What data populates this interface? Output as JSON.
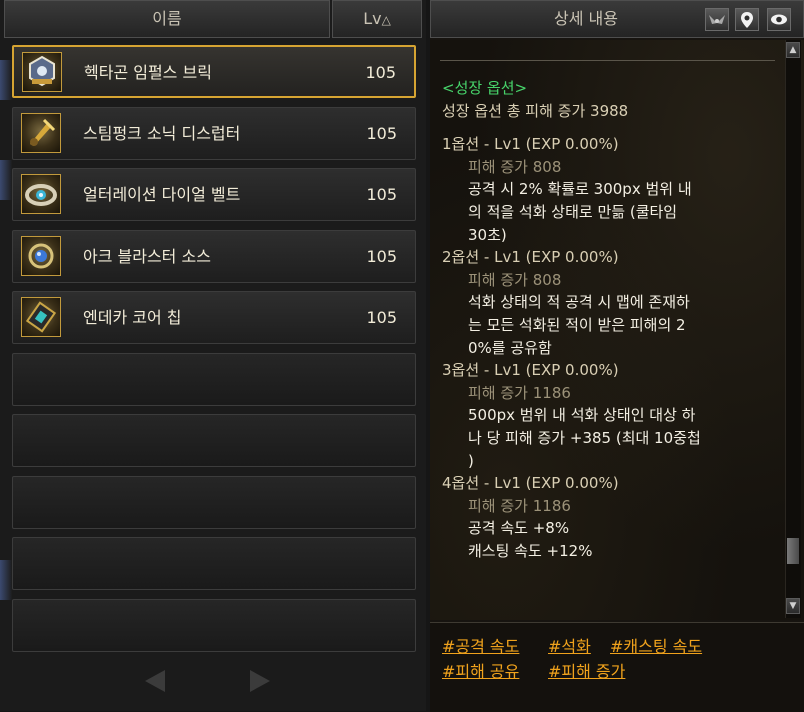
{
  "left_header": {
    "name_label": "이름",
    "lv_label": "Lv",
    "sort_icon": "triangle-up"
  },
  "items": [
    {
      "name": "헥타곤 임펄스 브릭",
      "level": "105",
      "selected": true,
      "icon": "hexagon-brick-icon"
    },
    {
      "name": "스팀펑크 소닉 디스럽터",
      "level": "105",
      "selected": false,
      "icon": "sonic-disruptor-icon"
    },
    {
      "name": "얼터레이션 다이얼 벨트",
      "level": "105",
      "selected": false,
      "icon": "dial-belt-icon"
    },
    {
      "name": "아크 블라스터 소스",
      "level": "105",
      "selected": false,
      "icon": "arc-blaster-icon"
    },
    {
      "name": "엔데카 코어 칩",
      "level": "105",
      "selected": false,
      "icon": "endeca-core-chip-icon"
    }
  ],
  "right_header": {
    "title": "상세 내용",
    "buttons": [
      "wing-icon",
      "map-pin-icon",
      "eye-icon"
    ]
  },
  "detail": {
    "section_title": "<성장 옵션>",
    "total_line": "성장 옵션 총 피해 증가 3988",
    "options": [
      {
        "header": "1옵션 - Lv1 (EXP 0.00%)",
        "damage": "피해 증가 808",
        "desc_lines": [
          "공격 시 2% 확률로 300px 범위 내",
          "의 적을 석화 상태로 만듦 (쿨타임",
          "30초)"
        ]
      },
      {
        "header": "2옵션 - Lv1 (EXP 0.00%)",
        "damage": "피해 증가 808",
        "desc_lines": [
          "석화 상태의 적 공격 시 맵에 존재하",
          "는 모든 석화된 적이 받은 피해의 2",
          "0%를 공유함"
        ]
      },
      {
        "header": "3옵션 - Lv1 (EXP 0.00%)",
        "damage": "피해 증가 1186",
        "desc_lines": [
          "500px 범위 내 석화 상태인 대상 하",
          "나 당 피해 증가 +385 (최대 10중첩",
          ")"
        ]
      },
      {
        "header": "4옵션 - Lv1 (EXP 0.00%)",
        "damage": "피해 증가 1186",
        "desc_lines": [
          "공격 속도 +8%",
          "캐스팅 속도 +12%"
        ]
      }
    ]
  },
  "tags": {
    "row1": [
      "#공격 속도",
      "#석화",
      "#캐스팅 속도"
    ],
    "row2": [
      "#피해 공유",
      "#피해 증가"
    ]
  },
  "colors": {
    "selected_border": "#d6a432",
    "section_title": "#47d36a",
    "tag_text": "#f0a21c",
    "dim_text": "#9c9279"
  }
}
